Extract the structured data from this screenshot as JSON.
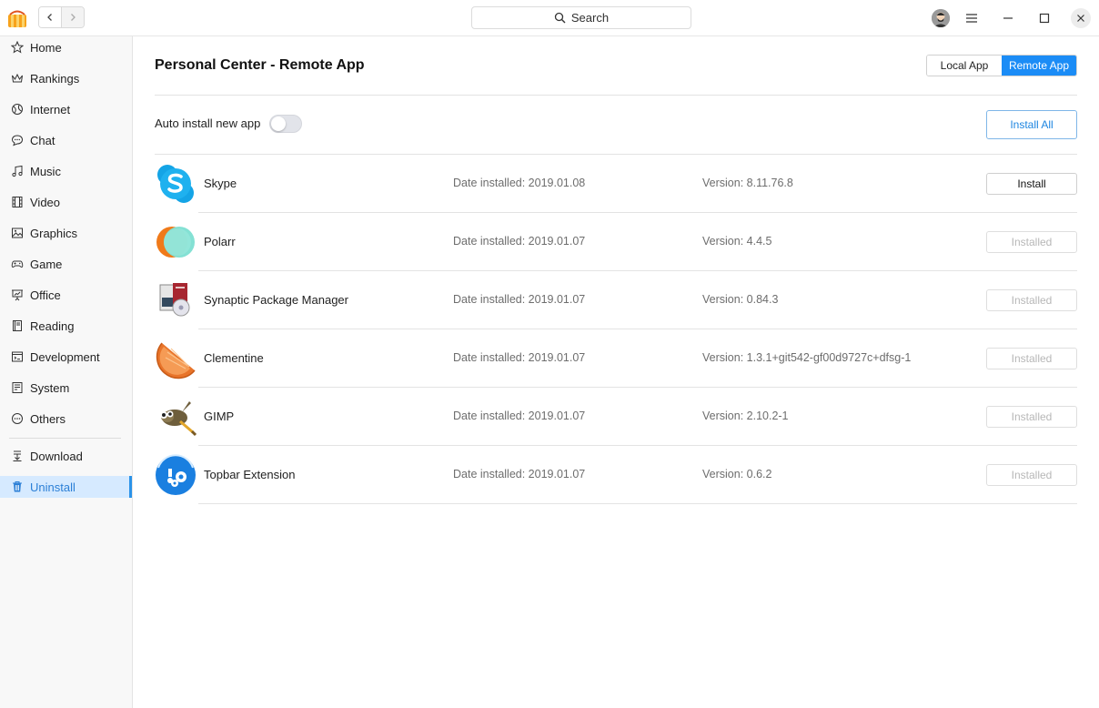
{
  "titlebar": {
    "search_label": "Search"
  },
  "sidebar": {
    "items": [
      {
        "label": "Home",
        "icon": "star-icon"
      },
      {
        "label": "Rankings",
        "icon": "crown-icon"
      },
      {
        "label": "Internet",
        "icon": "globe-icon"
      },
      {
        "label": "Chat",
        "icon": "chat-icon"
      },
      {
        "label": "Music",
        "icon": "music-note-icon"
      },
      {
        "label": "Video",
        "icon": "film-icon"
      },
      {
        "label": "Graphics",
        "icon": "picture-icon"
      },
      {
        "label": "Game",
        "icon": "gamepad-icon"
      },
      {
        "label": "Office",
        "icon": "presentation-icon"
      },
      {
        "label": "Reading",
        "icon": "book-icon"
      },
      {
        "label": "Development",
        "icon": "code-icon"
      },
      {
        "label": "System",
        "icon": "system-icon"
      },
      {
        "label": "Others",
        "icon": "more-icon"
      },
      {
        "label": "Download",
        "icon": "download-icon"
      },
      {
        "label": "Uninstall",
        "icon": "trash-icon"
      }
    ],
    "active": "Uninstall"
  },
  "main": {
    "title": "Personal Center - Remote App",
    "tabs": [
      {
        "label": "Local App",
        "selected": false
      },
      {
        "label": "Remote App",
        "selected": true
      }
    ],
    "auto_install_label": "Auto install new app",
    "auto_install_on": false,
    "install_all_label": "Install All",
    "apps": [
      {
        "name": "Skype",
        "date": "Date installed: 2019.01.08",
        "version": "Version: 8.11.76.8",
        "button": "Install",
        "icon": "skype-icon"
      },
      {
        "name": "Polarr",
        "date": "Date installed: 2019.01.07",
        "version": "Version: 4.4.5",
        "button": "Installed",
        "icon": "polarr-icon"
      },
      {
        "name": "Synaptic Package Manager",
        "date": "Date installed: 2019.01.07",
        "version": "Version: 0.84.3",
        "button": "Installed",
        "icon": "synaptic-icon"
      },
      {
        "name": "Clementine",
        "date": "Date installed: 2019.01.07",
        "version": "Version: 1.3.1+git542-gf00d9727c+dfsg-1",
        "button": "Installed",
        "icon": "clementine-icon"
      },
      {
        "name": "GIMP",
        "date": "Date installed: 2019.01.07",
        "version": "Version: 2.10.2-1",
        "button": "Installed",
        "icon": "gimp-icon"
      },
      {
        "name": "Topbar Extension",
        "date": "Date installed: 2019.01.07",
        "version": "Version: 0.6.2",
        "button": "Installed",
        "icon": "topbar-extension-icon"
      }
    ]
  },
  "colors": {
    "accent": "#1b8cf6",
    "active_sidebar_bg": "#d6eaff",
    "active_sidebar_text": "#2b7fd6"
  }
}
